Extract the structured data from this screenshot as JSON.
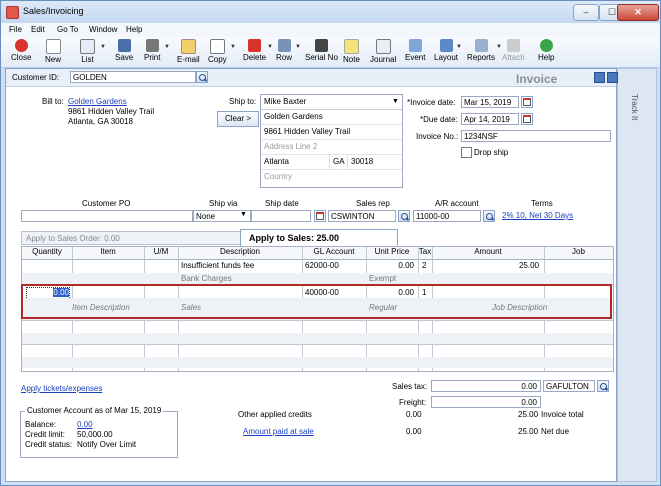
{
  "window": {
    "title": "Sales/Invoicing",
    "min": "–",
    "max": "☐",
    "close": "✕"
  },
  "menu": [
    "File",
    "Edit",
    "Go To",
    "Window",
    "Help"
  ],
  "toolbar": [
    "Close",
    "New",
    "List",
    "Save",
    "Print",
    "E-mail",
    "Copy",
    "Delete",
    "Row",
    "Serial No",
    "Note",
    "Journal",
    "Event",
    "Layout",
    "Reports",
    "Attach",
    "Help"
  ],
  "header": {
    "customer_id_label": "Customer ID:",
    "customer_id": "GOLDEN",
    "form_title": "Invoice"
  },
  "billto": {
    "label": "Bill to:",
    "name": "Golden Gardens",
    "line1": "9861 Hidden Valley Trail",
    "line2": "Atlanta, GA 30018"
  },
  "shipto": {
    "label": "Ship to:",
    "clear_label": "Clear >",
    "contact": "Mike Baxter",
    "name": "Golden Gardens",
    "addr1": "9861 Hidden Valley Trail",
    "addr2_placeholder": "Address Line 2",
    "city": "Atlanta",
    "state": "GA",
    "zip": "30018",
    "country_placeholder": "Country"
  },
  "invoice": {
    "date_label": "*Invoice date:",
    "date": "Mar 15, 2019",
    "due_label": "*Due date:",
    "due": "Apr 14, 2019",
    "no_label": "Invoice No.:",
    "no": "1234NSF",
    "dropship_label": "Drop ship"
  },
  "fields": {
    "customer_po_label": "Customer PO",
    "ship_via_label": "Ship via",
    "ship_via": "None",
    "ship_date_label": "Ship date",
    "sales_rep_label": "Sales rep",
    "sales_rep": "CSWINTON",
    "ar_label": "A/R account",
    "ar": "11000-00",
    "terms_label": "Terms",
    "terms": "2% 10, Net 30 Days"
  },
  "tabs": {
    "apply_order": "Apply to Sales Order: 0.00",
    "apply_sales": "Apply to Sales: 25.00"
  },
  "columns": [
    "Quantity",
    "Item",
    "U/M",
    "Description",
    "GL Account",
    "Unit Price",
    "Tax",
    "Amount",
    "Job"
  ],
  "rows": [
    {
      "qty": "",
      "item": "",
      "um": "",
      "desc": "Insufficient funds fee",
      "gl": "62000-00",
      "price": "0.00",
      "tax": "2",
      "amount": "25.00",
      "job": "",
      "sub_desc": "Bank Charges",
      "sub_gl": "Exempt"
    },
    {
      "qty": "0.00",
      "item": "",
      "um": "",
      "desc": "",
      "gl": "40000-00",
      "price": "0.00",
      "tax": "1",
      "amount": "",
      "job": "",
      "sub_item": "Item Description",
      "sub_desc": "Sales",
      "sub_gl": "Regular",
      "sub_job": "Job Description"
    }
  ],
  "footer": {
    "apply_tickets": "Apply tickets/expenses",
    "sales_tax_label": "Sales tax:",
    "sales_tax": "0.00",
    "tax_code": "GAFULTON",
    "freight_label": "Freight:",
    "freight": "0.00",
    "other_credits_label": "Other applied credits",
    "other_credits": "0.00",
    "invoice_total": "25.00",
    "invoice_total_label": "Invoice total",
    "amount_paid_label": "Amount paid at sale",
    "amount_paid": "0.00",
    "net_due": "25.00",
    "net_due_label": "Net due"
  },
  "account": {
    "title": "Customer Account as of Mar 15, 2019",
    "balance_label": "Balance:",
    "balance": "0.00",
    "credit_limit_label": "Credit limit:",
    "credit_limit": "50,000.00",
    "credit_status_label": "Credit status:",
    "credit_status": "Notify Over Limit"
  },
  "side": {
    "label": "Track It"
  },
  "colors": {
    "accent": "#1a3fbf",
    "selected_row": "#b02a2a"
  }
}
